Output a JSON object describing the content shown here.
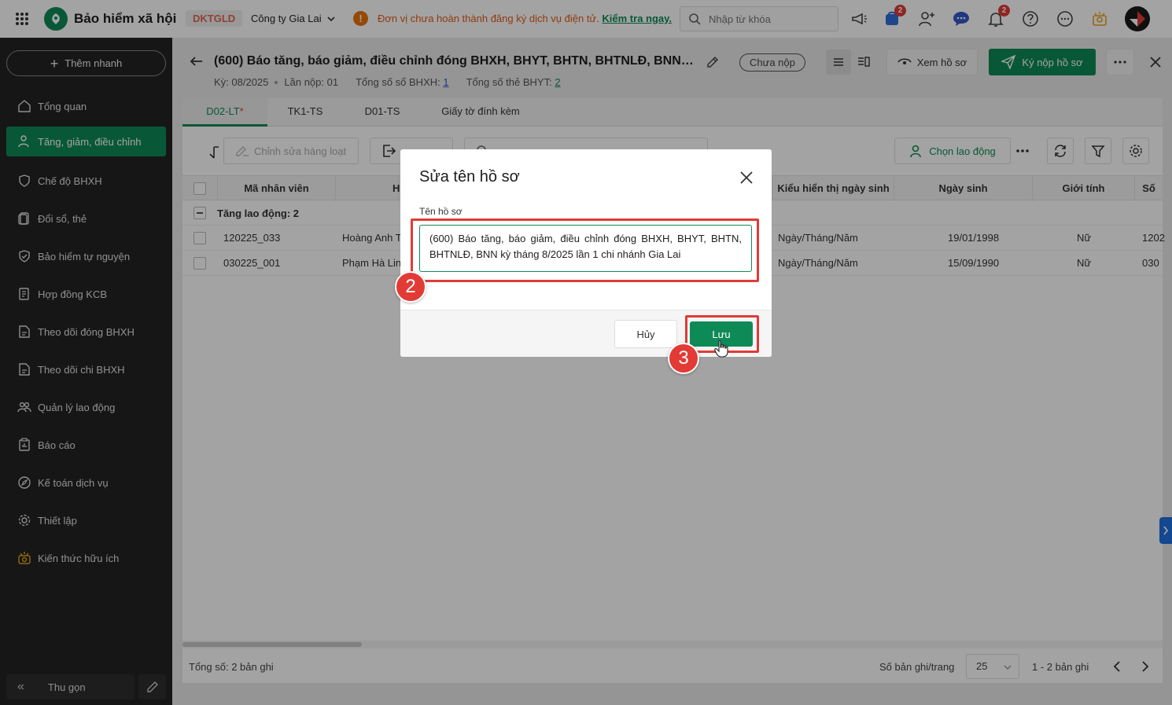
{
  "topbar": {
    "brand": "Bảo hiểm xã hội",
    "tax_code": "DKTGLD",
    "company": "Công ty Gia Lai",
    "warning_text": "Đơn vị chưa hoàn thành đăng ký dịch vụ điện tử.",
    "warning_link": "Kiểm tra ngay.",
    "search_placeholder": "Nhập từ khóa",
    "cart_badge": "2",
    "bell_badge": "2"
  },
  "sidebar": {
    "quick_add": "Thêm nhanh",
    "items": [
      {
        "label": "Tổng quan",
        "icon": "home-icon"
      },
      {
        "label": "Tăng, giảm, điều chỉnh",
        "icon": "user-switch-icon",
        "active": true
      },
      {
        "label": "Chế độ BHXH",
        "icon": "shield-icon"
      },
      {
        "label": "Đổi sổ, thẻ",
        "icon": "card-icon"
      },
      {
        "label": "Bảo hiểm tự nguyện",
        "icon": "shield-check-icon"
      },
      {
        "label": "Hợp đồng KCB",
        "icon": "contract-icon"
      },
      {
        "label": "Theo dõi đóng BHXH",
        "icon": "document-icon"
      },
      {
        "label": "Theo dõi chi BHXH",
        "icon": "document-icon"
      },
      {
        "label": "Quản lý lao động",
        "icon": "users-icon"
      },
      {
        "label": "Báo cáo",
        "icon": "report-icon"
      },
      {
        "label": "Kế toán dịch vụ",
        "icon": "compass-icon"
      },
      {
        "label": "Thiết lập",
        "icon": "gear-icon"
      },
      {
        "label": "Kiến thức hữu ích",
        "icon": "knowledge-icon"
      }
    ],
    "collapse": "Thu gọn"
  },
  "header": {
    "title": "(600) Báo tăng, báo giảm, điều chỉnh đóng BHXH, BHYT, BHTN, BHTNLĐ, BNN k...",
    "status": "Chưa nộp",
    "period": "Kỳ: 08/2025",
    "attempt": "Lần nộp: 01",
    "total_books_label": "Tổng số sổ BHXH:",
    "total_books": "1",
    "total_cards_label": "Tổng số thẻ BHYT:",
    "total_cards": "2",
    "view_button": "Xem hồ sơ",
    "submit_button": "Ký nộp hồ sơ"
  },
  "tabs": [
    {
      "label": "D02-LT",
      "required": "*",
      "active": true
    },
    {
      "label": "TK1-TS"
    },
    {
      "label": "D01-TS"
    },
    {
      "label": "Giấy tờ đính kèm"
    }
  ],
  "toolbar": {
    "bulk_edit": "Chỉnh sửa hàng loạt",
    "choose_employee": "Chọn lao động"
  },
  "table": {
    "columns": [
      "Mã nhân viên",
      "H",
      "Kiểu hiển thị ngày sinh",
      "Ngày sinh",
      "Giới tính",
      "Số"
    ],
    "group_label": "Tăng lao động: 2",
    "rows": [
      {
        "code": "120225_033",
        "name": "Hoàng Anh T",
        "dob_format": "Ngày/Tháng/Năm",
        "dob": "19/01/1998",
        "gender": "Nữ",
        "num": "1202"
      },
      {
        "code": "030225_001",
        "name": "Phạm Hà Linh",
        "dob_format": "Ngày/Tháng/Năm",
        "dob": "15/09/1990",
        "gender": "Nữ",
        "num": "030"
      }
    ]
  },
  "footer": {
    "total": "Tổng số: 2 bản ghi",
    "per_page_label": "Số bản ghi/trang",
    "per_page": "25",
    "range": "1 - 2 bản ghi"
  },
  "modal": {
    "title": "Sửa tên hồ sơ",
    "field_label": "Tên hồ sơ",
    "field_value": "(600) Báo tăng, báo giảm, điều chỉnh đóng BHXH, BHYT, BHTN, BHTNLĐ, BNN kỳ tháng 8/2025 lần 1 chi nhánh Gia Lai",
    "cancel": "Hủy",
    "save": "Lưu"
  },
  "annotations": {
    "step2": "2",
    "step3": "3",
    "highlight_color": "#e23b36"
  },
  "colors": {
    "brand_green": "#0e8a57",
    "sidebar_bg": "#232323",
    "warning_orange": "#e25c18"
  }
}
